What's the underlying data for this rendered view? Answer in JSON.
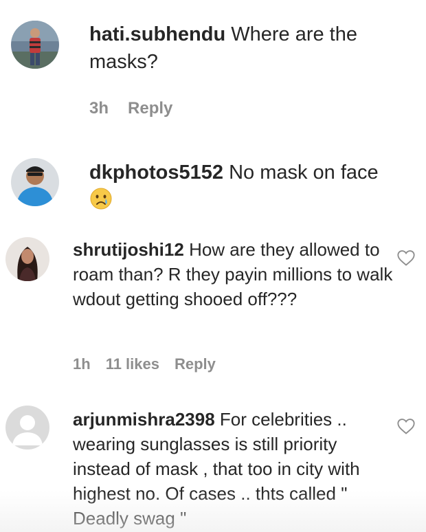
{
  "comments": [
    {
      "username": "hati.subhendu",
      "text": "Where are the masks?",
      "time": "3h",
      "reply_label": "Reply",
      "avatar_icon": "user-photo-avatar"
    },
    {
      "username": "dkphotos5152",
      "text": "No mask on face",
      "emoji": "crying-face-emoji",
      "avatar_icon": "user-photo-avatar"
    },
    {
      "username": "shrutijoshi12",
      "text": "How are they allowed to roam than? R they payin millions to walk wdout getting shooed off???",
      "time": "1h",
      "likes": "11 likes",
      "reply_label": "Reply",
      "avatar_icon": "user-photo-avatar",
      "like_icon": "heart-icon"
    },
    {
      "username": "arjunmishra2398",
      "text": "For celebrities .. wearing sunglasses is still priority instead of mask , that too in city with highest no. Of cases .. thts called \" Deadly swag \"",
      "avatar_icon": "default-avatar",
      "like_icon": "heart-icon"
    }
  ],
  "colors": {
    "text": "#262626",
    "meta": "#8e8e8e",
    "heart_stroke": "#8e8e8e"
  }
}
